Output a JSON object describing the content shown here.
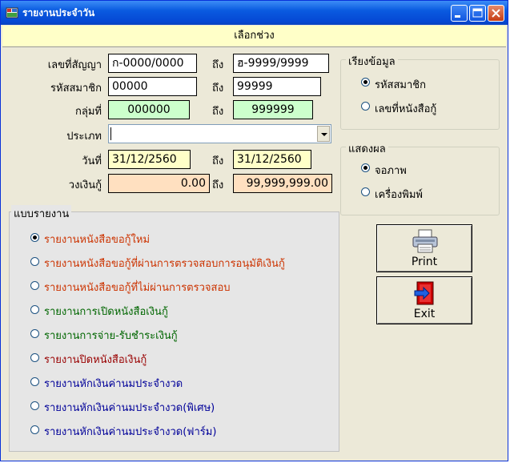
{
  "window": {
    "title": "รายงานประจำวัน"
  },
  "header": {
    "title": "เลือกช่วง"
  },
  "to_label": "ถึง",
  "filters": {
    "contract_no": {
      "label": "เลขที่สัญญา",
      "from": "ก-0000/0000",
      "to": "ฮ-9999/9999"
    },
    "member_code": {
      "label": "รหัสสมาชิก",
      "from": "00000",
      "to": "99999"
    },
    "group_no": {
      "label": "กลุ่มที่",
      "from": "000000",
      "to": "999999"
    },
    "type": {
      "label": "ประเภท",
      "value": ""
    },
    "date": {
      "label": "วันที่",
      "from": "31/12/2560",
      "to": "31/12/2560"
    },
    "loan_amount": {
      "label": "วงเงินกู้",
      "from": "0.00",
      "to": "99,999,999.00"
    }
  },
  "sort": {
    "title": "เรียงข้อมูล",
    "options": [
      {
        "label": "รหัสสมาชิก",
        "checked": true
      },
      {
        "label": "เลขที่หนังสือกู้",
        "checked": false
      }
    ]
  },
  "display": {
    "title": "แสดงผล",
    "options": [
      {
        "label": "จอภาพ",
        "checked": true
      },
      {
        "label": "เครื่องพิมพ์",
        "checked": false
      }
    ]
  },
  "report_type": {
    "title": "แบบรายงาน",
    "options": [
      {
        "label": "รายงานหนังสือขอกู้ใหม่",
        "color": "#cc3300",
        "checked": true
      },
      {
        "label": "รายงานหนังสือขอกู้ที่ผ่านการตรวจสอบการอนุมัติเงินกู้",
        "color": "#cc3300",
        "checked": false
      },
      {
        "label": "รายงานหนังสือขอกู้ที่ไม่ผ่านการตรวจสอบ",
        "color": "#cc3300",
        "checked": false
      },
      {
        "label": "รายงานการเปิดหนังสือเงินกู้",
        "color": "#006600",
        "checked": false
      },
      {
        "label": "รายงานการจ่าย-รับชำระเงินกู้",
        "color": "#006600",
        "checked": false
      },
      {
        "label": "รายงานปิดหนังสือเงินกู้",
        "color": "#990000",
        "checked": false
      },
      {
        "label": "รายงานหักเงินค่านมประจำงวด",
        "color": "#000099",
        "checked": false
      },
      {
        "label": "รายงานหักเงินค่านมประจำงวด(พิเศษ)",
        "color": "#000099",
        "checked": false
      },
      {
        "label": "รายงานหักเงินค่านมประจำงวด(ฟาร์ม)",
        "color": "#000099",
        "checked": false
      }
    ]
  },
  "buttons": {
    "print": "Print",
    "exit": "Exit"
  }
}
